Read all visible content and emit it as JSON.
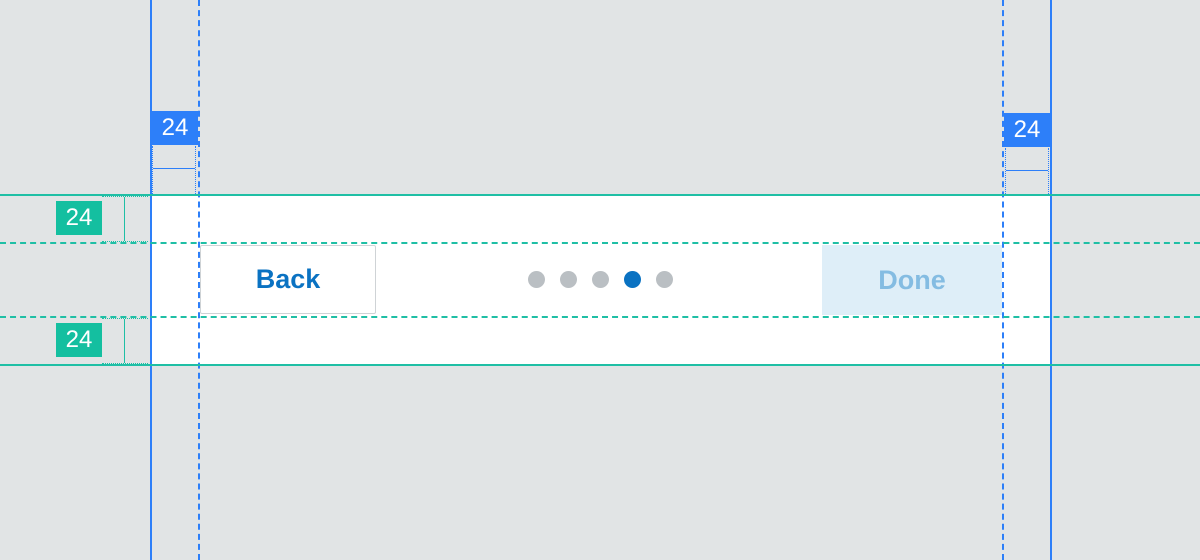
{
  "spec": {
    "top_horizontal_padding": "24",
    "bottom_horizontal_padding": "24",
    "left_inset": "24",
    "right_inset": "24"
  },
  "footer": {
    "back_label": "Back",
    "done_label": "Done",
    "step_count": 5,
    "current_step": 4
  },
  "colors": {
    "background": "#e1e4e5",
    "guide_blue": "#2d7ff9",
    "guide_green": "#1fbfa5",
    "primary": "#0a72c2",
    "done_disabled_bg": "#deeef8",
    "done_disabled_text": "#84bce2",
    "dot_inactive": "#babfc3"
  }
}
